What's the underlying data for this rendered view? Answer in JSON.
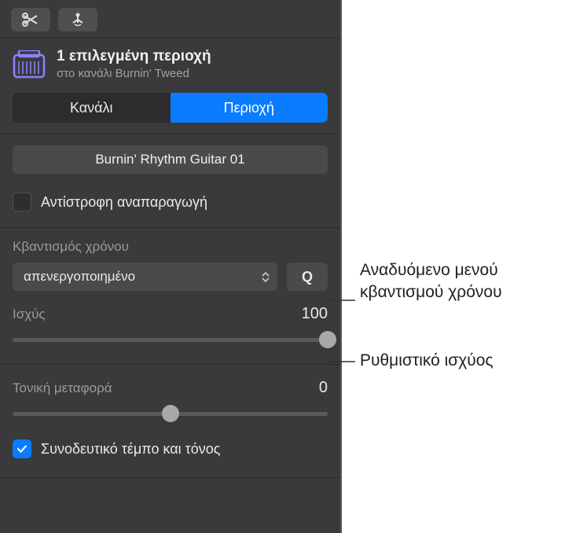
{
  "region": {
    "title": "1 επιλεγμένη περιοχή",
    "subtitle": "στο κανάλι Burnin' Tweed"
  },
  "tabs": {
    "channel": "Κανάλι",
    "region": "Περιοχή"
  },
  "regionName": "Burnin' Rhythm Guitar 01",
  "reversePlayback": {
    "label": "Αντίστροφη αναπαραγωγή",
    "checked": false
  },
  "timeQuantize": {
    "label": "Κβαντισμός χρόνου",
    "value": "απενεργοποιημένο",
    "qButton": "Q"
  },
  "strength": {
    "label": "Ισχύς",
    "value": "100",
    "position": 100
  },
  "transpose": {
    "label": "Τονική μεταφορά",
    "value": "0",
    "position": 50
  },
  "followTempo": {
    "label": "Συνοδευτικό τέμπο και τόνος",
    "checked": true
  },
  "callouts": {
    "quantizeMenu": "Αναδυόμενο μενού κβαντισμού χρόνου",
    "strengthSlider": "Ρυθμιστικό ισχύος"
  }
}
